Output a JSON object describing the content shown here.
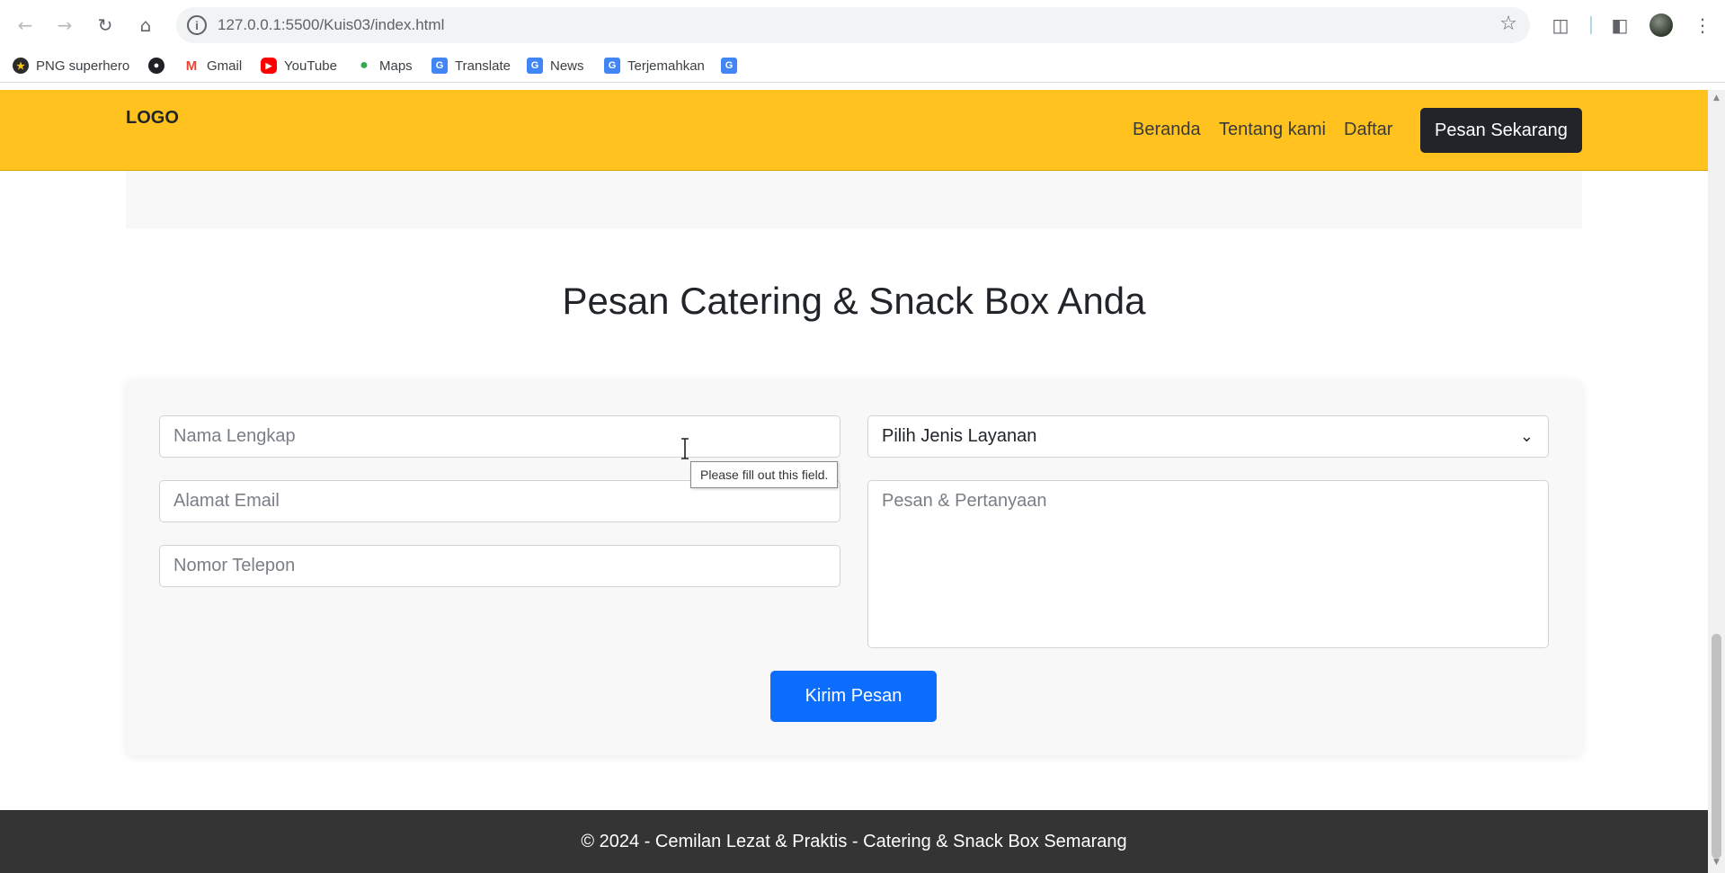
{
  "browser": {
    "url": "127.0.0.1:5500/Kuis03/index.html",
    "bookmarks": [
      {
        "label": "PNG superhero",
        "icon": "star-badge-icon"
      },
      {
        "label": "",
        "icon": "globe-icon"
      },
      {
        "label": "Gmail",
        "icon": "gmail-icon"
      },
      {
        "label": "YouTube",
        "icon": "youtube-icon"
      },
      {
        "label": "Maps",
        "icon": "maps-pin-icon"
      },
      {
        "label": "Translate",
        "icon": "translate-icon"
      },
      {
        "label": "News",
        "icon": "news-icon"
      },
      {
        "label": "Terjemahkan",
        "icon": "translate-icon"
      },
      {
        "label": "",
        "icon": "google-translate-icon"
      }
    ]
  },
  "header": {
    "logo": "LOGO",
    "menu": [
      "Beranda",
      "Tentang kami",
      "Daftar"
    ],
    "cta": "Pesan Sekarang"
  },
  "section": {
    "title": "Pesan Catering & Snack Box Anda"
  },
  "form": {
    "name_placeholder": "Nama Lengkap",
    "email_placeholder": "Alamat Email",
    "phone_placeholder": "Nomor Telepon",
    "service_selected": "Pilih Jenis Layanan",
    "message_placeholder": "Pesan & Pertanyaan",
    "submit": "Kirim Pesan",
    "validation_tooltip": "Please fill out this field."
  },
  "footer": {
    "text": "© 2024 - Cemilan Lezat & Praktis - Catering & Snack Box Semarang"
  },
  "colors": {
    "navbar": "#ffc21e",
    "cta": "#212529",
    "submit": "#0d6efd",
    "footer": "#343434"
  }
}
